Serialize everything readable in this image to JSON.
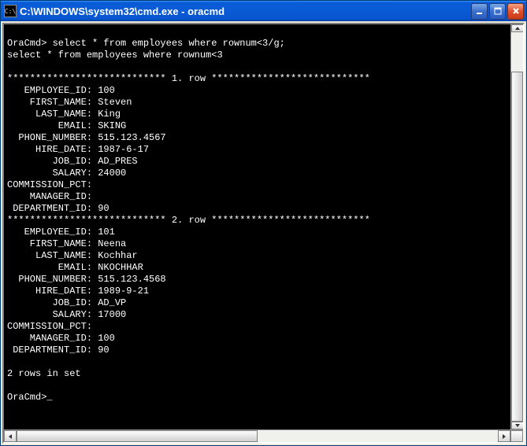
{
  "window": {
    "icon_label": "C:\\",
    "title": "C:\\WINDOWS\\system32\\cmd.exe - oracmd"
  },
  "terminal": {
    "prompt": "OraCmd>",
    "command": "select * from employees where rownum<3/g;",
    "echo": "select * from employees where rownum<3",
    "row_sep_prefix": "****************************",
    "row_sep_suffix": "****************************",
    "row1_label": " 1. row ",
    "row2_label": " 2. row ",
    "fields": [
      "EMPLOYEE_ID",
      "FIRST_NAME",
      "LAST_NAME",
      "EMAIL",
      "PHONE_NUMBER",
      "HIRE_DATE",
      "JOB_ID",
      "SALARY",
      "COMMISSION_PCT",
      "MANAGER_ID",
      "DEPARTMENT_ID"
    ],
    "row1": {
      "EMPLOYEE_ID": "100",
      "FIRST_NAME": "Steven",
      "LAST_NAME": "King",
      "EMAIL": "SKING",
      "PHONE_NUMBER": "515.123.4567",
      "HIRE_DATE": "1987-6-17",
      "JOB_ID": "AD_PRES",
      "SALARY": "24000",
      "COMMISSION_PCT": "",
      "MANAGER_ID": "",
      "DEPARTMENT_ID": "90"
    },
    "row2": {
      "EMPLOYEE_ID": "101",
      "FIRST_NAME": "Neena",
      "LAST_NAME": "Kochhar",
      "EMAIL": "NKOCHHAR",
      "PHONE_NUMBER": "515.123.4568",
      "HIRE_DATE": "1989-9-21",
      "JOB_ID": "AD_VP",
      "SALARY": "17000",
      "COMMISSION_PCT": "",
      "MANAGER_ID": "100",
      "DEPARTMENT_ID": "90"
    },
    "footer": "2 rows in set",
    "final_prompt": "OraCmd>"
  }
}
